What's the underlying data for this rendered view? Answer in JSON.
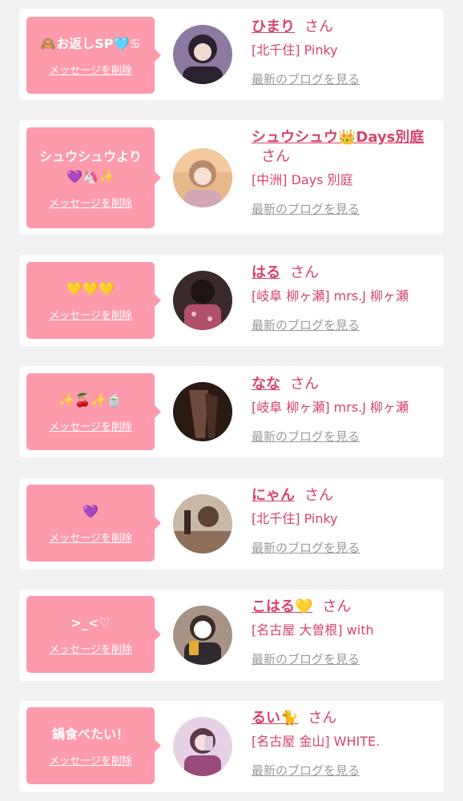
{
  "delete_label": "メッセージを削除",
  "honorific": "さん",
  "blog_label": "最新のブログを見る",
  "colors": {
    "bubble": "#fd9aab",
    "accent": "#d8436b",
    "link_gray": "#9a9a9a",
    "background": "#f2f2f4"
  },
  "entries": [
    {
      "message": "🙈お返しSP🩵♋",
      "name": "ひまり",
      "shop": "[北千住] Pinky",
      "avatar_icon": "girl-portrait-icon"
    },
    {
      "message": "シュウシュウより\n💜🦄✨",
      "name": "シュウシュウ👑Days別庭",
      "shop": "[中洲] Days 別庭",
      "avatar_icon": "girl-portrait-icon"
    },
    {
      "message": "💛💛💛",
      "name": "はる",
      "shop": "[岐阜 柳ヶ瀬] mrs.J 柳ヶ瀬",
      "avatar_icon": "girl-portrait-icon"
    },
    {
      "message": "✨🍒✨🍵",
      "name": "なな",
      "shop": "[岐阜 柳ヶ瀬] mrs.J 柳ヶ瀬",
      "avatar_icon": "girl-portrait-icon"
    },
    {
      "message": "💜",
      "name": "にゃん",
      "shop": "[北千住] Pinky",
      "avatar_icon": "girl-portrait-icon"
    },
    {
      "message": ">_<♡",
      "name": "こはる💛",
      "shop": "[名古屋 大曽根] with",
      "avatar_icon": "girl-portrait-icon"
    },
    {
      "message": "鍋食べたい！",
      "name": "るい🐈",
      "shop": "[名古屋 金山] WHITE.",
      "avatar_icon": "girl-portrait-icon"
    }
  ]
}
